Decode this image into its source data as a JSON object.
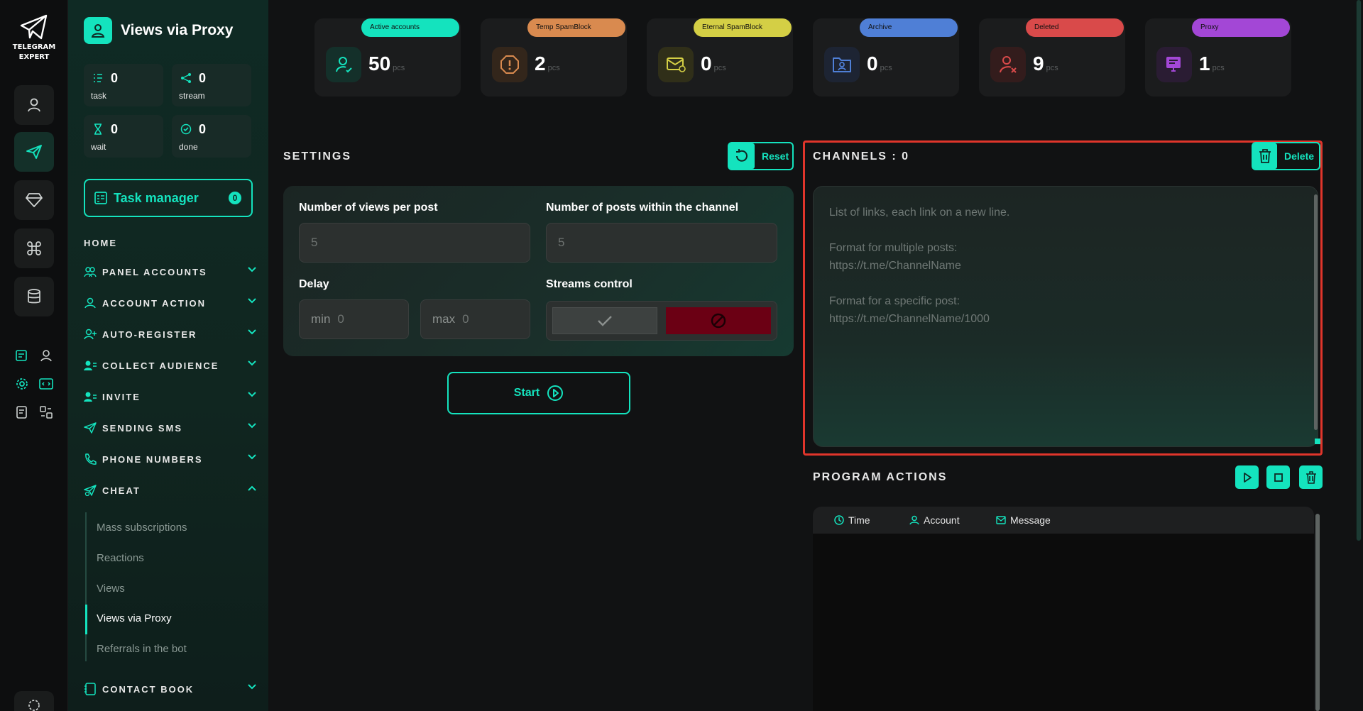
{
  "app": {
    "logo_line1": "TELEGRAM",
    "logo_line2": "EXPERT"
  },
  "sidebar": {
    "title": "Views via Proxy",
    "stats": [
      {
        "value": "0",
        "label": "task"
      },
      {
        "value": "0",
        "label": "stream"
      },
      {
        "value": "0",
        "label": "wait"
      },
      {
        "value": "0",
        "label": "done"
      }
    ],
    "task_manager": {
      "label": "Task manager",
      "count": "0"
    },
    "home_label": "HOME",
    "nav": [
      {
        "label": "PANEL ACCOUNTS"
      },
      {
        "label": "ACCOUNT ACTION"
      },
      {
        "label": "AUTO-REGISTER"
      },
      {
        "label": "COLLECT AUDIENCE"
      },
      {
        "label": "INVITE"
      },
      {
        "label": "SENDING SMS"
      },
      {
        "label": "PHONE NUMBERS"
      },
      {
        "label": "CHEAT"
      },
      {
        "label": "CONTACT BOOK"
      }
    ],
    "cheat_sub": [
      {
        "label": "Mass subscriptions"
      },
      {
        "label": "Reactions"
      },
      {
        "label": "Views"
      },
      {
        "label": "Views via Proxy"
      },
      {
        "label": "Referrals in the bot"
      }
    ]
  },
  "stat_cards": [
    {
      "label": "Active accounts",
      "value": "50",
      "unit": "pcs",
      "color": "#14e3be",
      "icon": "user-check-icon"
    },
    {
      "label": "Temp SpamBlock",
      "value": "2",
      "unit": "pcs",
      "color": "#d98a4f",
      "icon": "warning-octagon-icon"
    },
    {
      "label": "Eternal SpamBlock",
      "value": "0",
      "unit": "pcs",
      "color": "#d4cf45",
      "icon": "mail-block-icon"
    },
    {
      "label": "Archive",
      "value": "0",
      "unit": "pcs",
      "color": "#4f7fd6",
      "icon": "folder-user-icon"
    },
    {
      "label": "Deleted",
      "value": "9",
      "unit": "pcs",
      "color": "#d94a4a",
      "icon": "user-x-icon"
    },
    {
      "label": "Proxy",
      "value": "1",
      "unit": "pcs",
      "color": "#a347d6",
      "icon": "proxy-screen-icon"
    }
  ],
  "settings": {
    "title": "SETTINGS",
    "reset_label": "Reset",
    "views_per_post_label": "Number of views per post",
    "views_per_post_placeholder": "5",
    "posts_in_channel_label": "Number of posts within the channel",
    "posts_in_channel_placeholder": "5",
    "delay_label": "Delay",
    "delay_min_prefix": "min",
    "delay_min_value": "0",
    "delay_max_prefix": "max",
    "delay_max_value": "0",
    "streams_label": "Streams control",
    "start_label": "Start"
  },
  "channels": {
    "title": "CHANNELS : 0",
    "delete_label": "Delete",
    "placeholder": "List of links, each link on a new line.\n\nFormat for multiple posts:\nhttps://t.me/ChannelName\n\nFormat for a specific post:\nhttps://t.me/ChannelName/1000"
  },
  "program_actions": {
    "title": "PROGRAM ACTIONS",
    "columns": [
      {
        "label": "Time"
      },
      {
        "label": "Account"
      },
      {
        "label": "Message"
      }
    ]
  },
  "colors": {
    "accent": "#14e3be",
    "highlight_frame": "#e0352b",
    "stop_stream": "#6b0014"
  }
}
